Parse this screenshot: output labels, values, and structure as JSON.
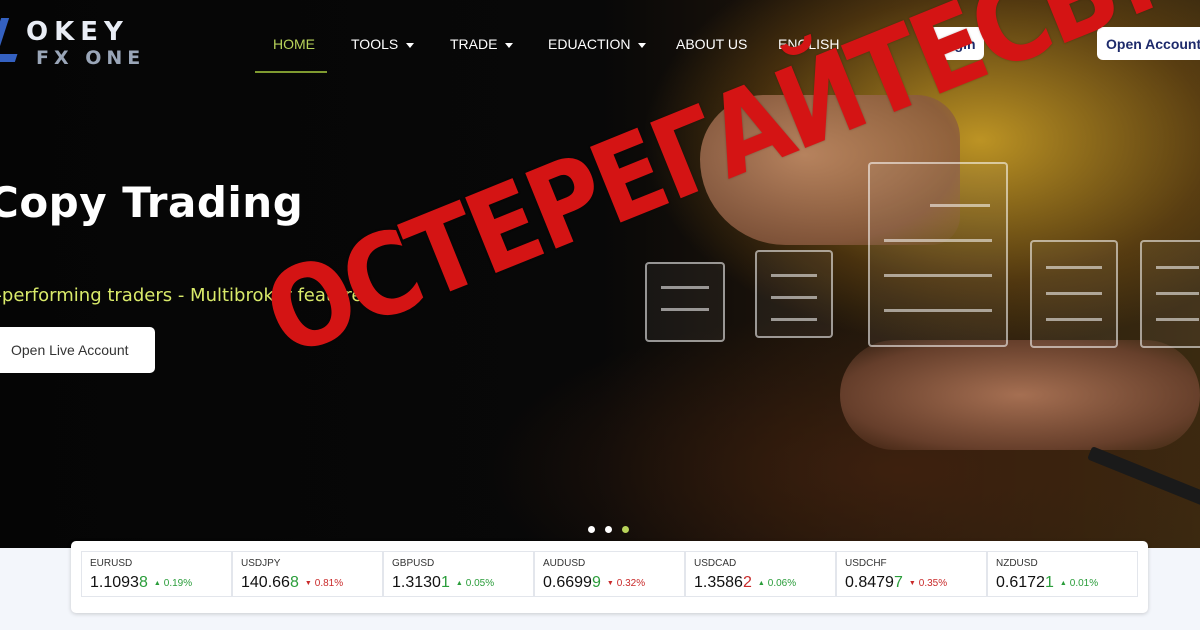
{
  "logo": {
    "line1": "OKEY",
    "line2": "FX ONE"
  },
  "nav": {
    "items": [
      {
        "label": "HOME"
      },
      {
        "label": "TOOLS"
      },
      {
        "label": "TRADE"
      },
      {
        "label": "EDUACTION"
      },
      {
        "label": "ABOUT US"
      },
      {
        "label": "ENGLISH"
      }
    ],
    "login_label": "Login",
    "open_account_label": "Open Account"
  },
  "hero": {
    "title": "Copy Trading",
    "subtitle": "p-performing traders - Multibroker feature",
    "cta_label": "Open Live Account",
    "stamp_text": "ОСТЕРЕГАЙТЕСЬ!"
  },
  "colors": {
    "accent": "#b8d35a",
    "brand_navy": "#1d2a6b",
    "stamp_red": "#d41414",
    "up": "#2a9d3a",
    "down": "#c92a2a"
  },
  "ticker": [
    {
      "symbol": "EURUSD",
      "price_main": "1.1093",
      "price_last": "8",
      "change": "0.19%",
      "dir": "up"
    },
    {
      "symbol": "USDJPY",
      "price_main": "140.66",
      "price_last": "8",
      "change": "0.81%",
      "dir": "down"
    },
    {
      "symbol": "GBPUSD",
      "price_main": "1.3130",
      "price_last": "1",
      "change": "0.05%",
      "dir": "up"
    },
    {
      "symbol": "AUDUSD",
      "price_main": "0.6699",
      "price_last": "9",
      "change": "0.32%",
      "dir": "down"
    },
    {
      "symbol": "USDCAD",
      "price_main": "1.3586",
      "price_last": "2",
      "change": "0.06%",
      "dir": "up"
    },
    {
      "symbol": "USDCHF",
      "price_main": "0.8479",
      "price_last": "7",
      "change": "0.35%",
      "dir": "down"
    },
    {
      "symbol": "NZDUSD",
      "price_main": "0.6172",
      "price_last": "1",
      "change": "0.01%",
      "dir": "up"
    }
  ]
}
